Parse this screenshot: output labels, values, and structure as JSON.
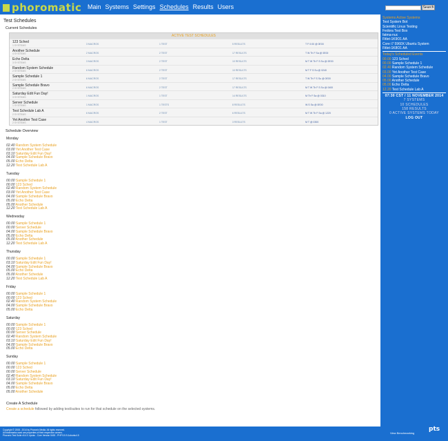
{
  "brand": "phoromatic",
  "nav": [
    {
      "label": "Main"
    },
    {
      "label": "Systems"
    },
    {
      "label": "Settings"
    },
    {
      "label": "Schedules",
      "active": true
    },
    {
      "label": "Results"
    },
    {
      "label": "Users"
    }
  ],
  "search": {
    "button": "Search"
  },
  "page": {
    "title": "Test Schedules",
    "current_heading": "Current Schedules",
    "table_title": "ACTIVE TEST SCHEDULES"
  },
  "schedules": [
    {
      "name": "123 Sched",
      "sub": "1 SYSTEMS",
      "c1": "3 MACROS",
      "c2": "1 TEST",
      "c3": "5 RESULTS",
      "c4": "T F 0:00 @ 0E00"
    },
    {
      "name": "Another Schedule",
      "sub": "4 SYSTEMS",
      "c1": "2 MACROS",
      "c2": "2 TEST",
      "c3": "17 RESULTS",
      "c4": "T W Th F Sa @ 0E00"
    },
    {
      "name": "Echo Delta",
      "sub": "3 SYSTEMS",
      "c1": "3 MACROS",
      "c2": "2 TEST",
      "c3": "10 RESULTS",
      "c4": "M T W Th F S Su @ 0E00"
    },
    {
      "name": "Random System Schedule",
      "sub": "2 SYSTEMS",
      "c1": "6 MACROS",
      "c2": "2 TEST",
      "c3": "10 RESULTS",
      "c4": "M T F S Su @ 0240"
    },
    {
      "name": "Sample Schedule 1",
      "sub": "2 SYSTEMS",
      "c1": "6 MACROS",
      "c2": "2 TEST",
      "c3": "17 RESULTS",
      "c4": "T W Th F S Su @ 0E00"
    },
    {
      "name": "Sample Schedule Bravo",
      "sub": "2 SYSTEMS",
      "c1": "6 MACROS",
      "c2": "2 TEST",
      "c3": "17 RESULTS",
      "c4": "M T W Th F S Su @ 0400"
    },
    {
      "name": "Saturday Edit Fun Day!",
      "sub": "3 SYSTEMS",
      "c1": "1 MACROS",
      "c2": "1 TEST",
      "c3": "14 RESULTS",
      "c4": "M Th F Sa @ 0310"
    },
    {
      "name": "Server Schedule",
      "sub": "1 SYSTEMS",
      "c1": "1 MACROS",
      "c2": "1 TESTS",
      "c3": "8 RESULTS",
      "c4": "W S Sa @ 0E00"
    },
    {
      "name": "Test Schedule Lab A",
      "sub": "2 SYSTEMS",
      "c1": "6 MACROS",
      "c2": "2 TEST",
      "c3": "6 RESULTS",
      "c4": "M T W Th F Sa @ 1220"
    },
    {
      "name": "Yet Another Test Case",
      "sub": "2 SYSTEMS",
      "c1": "4 MACROS",
      "c2": "1 TEST",
      "c3": "3 RESULTS",
      "c4": "M T @ 0300"
    }
  ],
  "overview": {
    "heading": "Schedule Overview",
    "days": [
      {
        "name": "Monday",
        "items": [
          [
            "02.40",
            "Random System Schedule"
          ],
          [
            "03.00",
            "Yet Another Test Case"
          ],
          [
            "03.10",
            "Saturday Edit Fun Day!"
          ],
          [
            "04.00",
            "Sample Schedule Bravo"
          ],
          [
            "05.00",
            "Echo Delta"
          ],
          [
            "12.20",
            "Test Schedule Lab A"
          ]
        ]
      },
      {
        "name": "Tuesday",
        "items": [
          [
            "00.00",
            "Sample Schedule 1"
          ],
          [
            "00.00",
            "123 Sched"
          ],
          [
            "02.40",
            "Random System Schedule"
          ],
          [
            "03.00",
            "Yet Another Test Case"
          ],
          [
            "04.00",
            "Sample Schedule Bravo"
          ],
          [
            "05.00",
            "Echo Delta"
          ],
          [
            "05.00",
            "Another Schedule"
          ],
          [
            "12.20",
            "Test Schedule Lab A"
          ]
        ]
      },
      {
        "name": "Wednesday",
        "items": [
          [
            "00.00",
            "Sample Schedule 1"
          ],
          [
            "00.00",
            "Server Schedule"
          ],
          [
            "04.00",
            "Sample Schedule Bravo"
          ],
          [
            "05.00",
            "Echo Delta"
          ],
          [
            "05.00",
            "Another Schedule"
          ],
          [
            "12.20",
            "Test Schedule Lab A"
          ]
        ]
      },
      {
        "name": "Thursday",
        "items": [
          [
            "00.00",
            "Sample Schedule 1"
          ],
          [
            "03.10",
            "Saturday Edit Fun Day!"
          ],
          [
            "04.00",
            "Sample Schedule Bravo"
          ],
          [
            "05.00",
            "Echo Delta"
          ],
          [
            "05.00",
            "Another Schedule"
          ],
          [
            "12.20",
            "Test Schedule Lab A"
          ]
        ]
      },
      {
        "name": "Friday",
        "items": [
          [
            "00.00",
            "Sample Schedule 1"
          ],
          [
            "00.00",
            "123 Sched"
          ],
          [
            "02.40",
            "Random System Schedule"
          ],
          [
            "04.00",
            "Sample Schedule Bravo"
          ],
          [
            "05.00",
            "Echo Delta"
          ]
        ]
      },
      {
        "name": "Saturday",
        "items": [
          [
            "00.00",
            "Sample Schedule 1"
          ],
          [
            "00.00",
            "123 Sched"
          ],
          [
            "00.00",
            "Server Schedule"
          ],
          [
            "02.40",
            "Random System Schedule"
          ],
          [
            "03.10",
            "Saturday Edit Fun Day!"
          ],
          [
            "04.00",
            "Sample Schedule Bravo"
          ],
          [
            "05.00",
            "Echo Delta"
          ]
        ]
      },
      {
        "name": "Sunday",
        "items": [
          [
            "00.00",
            "Sample Schedule 1"
          ],
          [
            "00.00",
            "123 Sched"
          ],
          [
            "00.00",
            "Server Schedule"
          ],
          [
            "02.40",
            "Random System Schedule"
          ],
          [
            "03.10",
            "Saturday Edit Fun Day!"
          ],
          [
            "04.00",
            "Sample Schedule Bravo"
          ],
          [
            "05.00",
            "Echo Delta"
          ],
          [
            "05.00",
            "Another Schedule"
          ]
        ]
      }
    ]
  },
  "create": {
    "heading": "Create A Schedule",
    "link": "Create a schedule",
    "text": "followed by adding test/suites to run for that schedule on the selected systems."
  },
  "sidebar": {
    "systems_heading": "Systems Active Systems",
    "systems": [
      "Test System Bot",
      "Scientific Linux Testing",
      "Fedora Test Box",
      "fatma-nuc",
      "Fitlet-1K9O1 AA",
      "Core i7 5960X Ubuntu System",
      "Fitlet-1K8O1 AA"
    ],
    "today_heading": "Today's Scheduled Events",
    "events": [
      [
        "00.00",
        "123 Sched"
      ],
      [
        "00.00",
        "Sample Schedule 1"
      ],
      [
        "02.40",
        "Random System Schedule"
      ],
      [
        "03.00",
        "Yet Another Test Case"
      ],
      [
        "04.00",
        "Sample Schedule Bravo"
      ],
      [
        "05.00",
        "Another Schedule"
      ],
      [
        "05.00",
        "Echo Delta"
      ],
      [
        "12.20",
        "Test Schedule Lab A"
      ]
    ],
    "date": "07:30 CST / 11 NOVEMBER 2014",
    "stats": [
      "7 SYSTEMS",
      "10 SCHEDULES",
      "158 RESULTS",
      "0 ACTIVE SYSTEMS TODAY"
    ],
    "logout": "LOG OUT"
  },
  "footer": {
    "lines": [
      "Copyright © 2008 - 2014 by Phoronix Media. All rights reserved.",
      "All trademarks used are properties of their respective owners.",
      "Phoronix Test Suite v5.4.0 Lipsko - Core Version 5400 - PHP 5.5.9-1ubuntu4.5"
    ],
    "vb": "View Benchmarking",
    "logo": "pts"
  }
}
